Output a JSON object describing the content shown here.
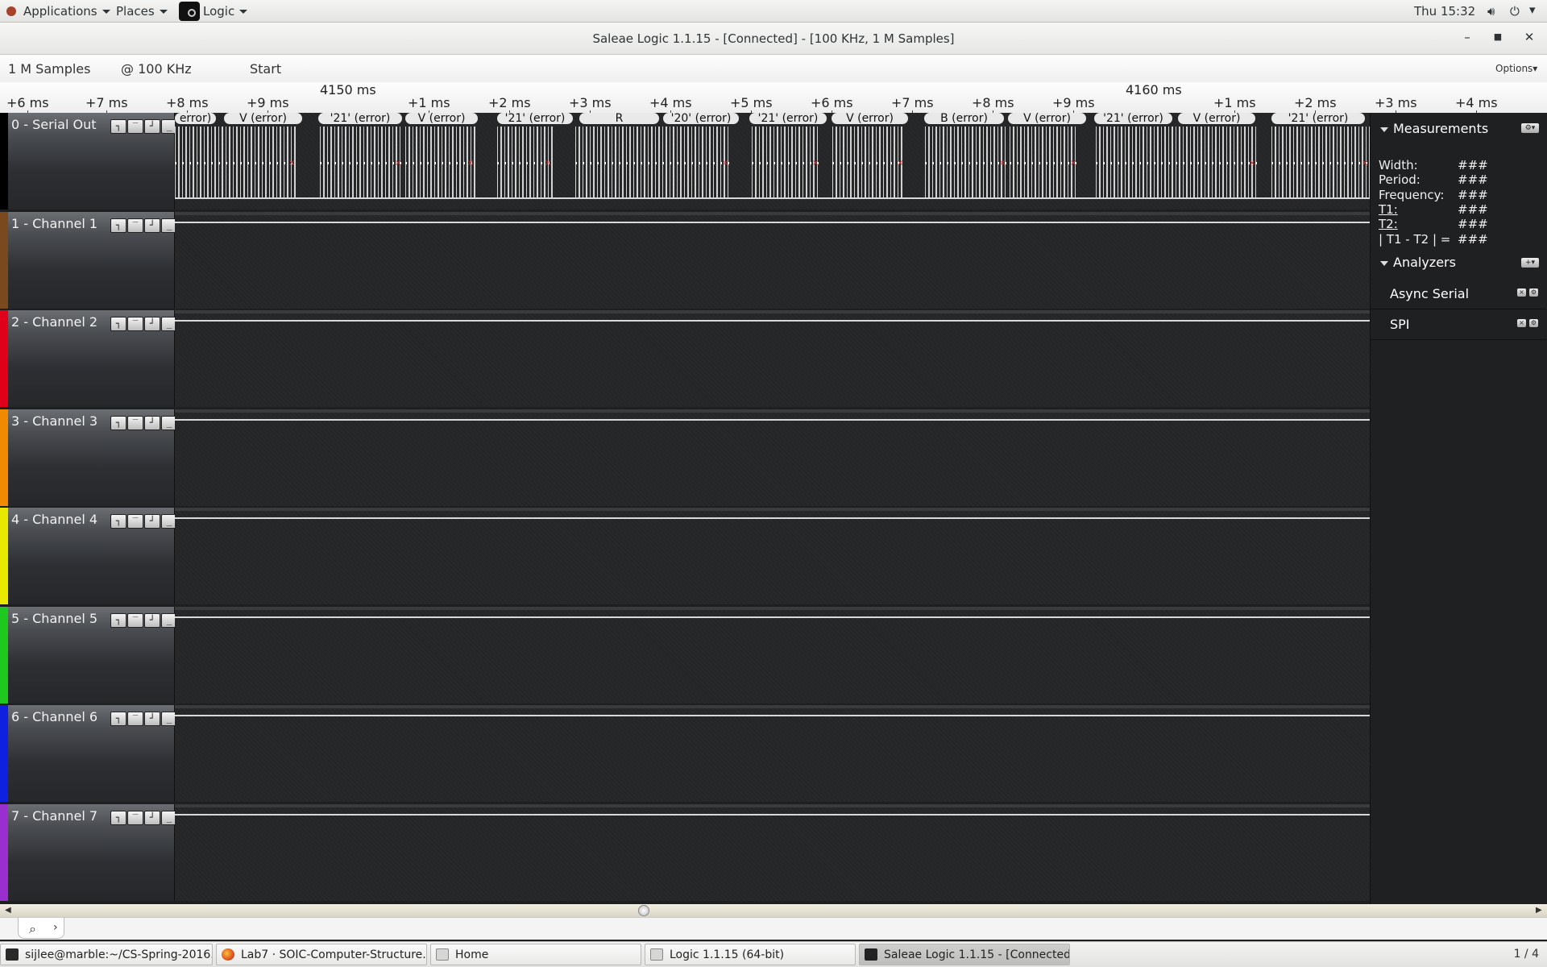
{
  "topbar": {
    "applications_label": "Applications",
    "places_label": "Places",
    "app_label": "Logic",
    "clock": "Thu 15:32"
  },
  "window": {
    "title": "Saleae Logic 1.1.15 - [Connected] - [100 KHz, 1 M Samples]"
  },
  "controls": {
    "samples": "1 M Samples",
    "rate": "@ 100 KHz",
    "start_label": "Start",
    "options_label": "Options▾"
  },
  "ruler": {
    "majors": [
      "4150 ms",
      "4160 ms"
    ],
    "ticks": [
      "+6 ms",
      "+7 ms",
      "+8 ms",
      "+9 ms",
      "+1 ms",
      "+2 ms",
      "+3 ms",
      "+4 ms",
      "+5 ms",
      "+6 ms",
      "+7 ms",
      "+8 ms",
      "+9 ms",
      "+1 ms",
      "+2 ms",
      "+3 ms",
      "+4 ms"
    ]
  },
  "channels": [
    {
      "name": "0 - Serial Out",
      "color": "#000000"
    },
    {
      "name": "1 - Channel 1",
      "color": "#7a4a1e"
    },
    {
      "name": "2 - Channel 2",
      "color": "#e0001a"
    },
    {
      "name": "3 - Channel 3",
      "color": "#f08a00"
    },
    {
      "name": "4 - Channel 4",
      "color": "#e8e800"
    },
    {
      "name": "5 - Channel 5",
      "color": "#1ec81e"
    },
    {
      "name": "6 - Channel 6",
      "color": "#1020e0"
    },
    {
      "name": "7 - Channel 7",
      "color": "#9a2fd0"
    }
  ],
  "decodes": [
    "error)",
    "V (error)",
    "'21' (error)",
    "V (error)",
    "'21' (error)",
    "R",
    "'20' (error)",
    "'21' (error)",
    "V (error)",
    "B (error)",
    "V (error)",
    "'21' (error)",
    "V (error)",
    "'21' (error)"
  ],
  "measurements": {
    "title": "Measurements",
    "rows": [
      {
        "label": "Width:",
        "value": "###"
      },
      {
        "label": "Period:",
        "value": "###"
      },
      {
        "label": "Frequency:",
        "value": "###"
      },
      {
        "label": "T1:",
        "value": "###"
      },
      {
        "label": "T2:",
        "value": "###"
      },
      {
        "label": "| T1 - T2 | =",
        "value": "###"
      }
    ]
  },
  "analyzers": {
    "title": "Analyzers",
    "items": [
      "Async Serial",
      "SPI"
    ]
  },
  "taskbar": {
    "tasks": [
      "sijlee@marble:~/CS-Spring-2016...",
      "Lab7 · SOIC-Computer-Structure...",
      "Home",
      "Logic 1.1.15 (64-bit)",
      "Saleae Logic 1.1.15 - [Connected..."
    ],
    "workspace": "1 / 4"
  }
}
